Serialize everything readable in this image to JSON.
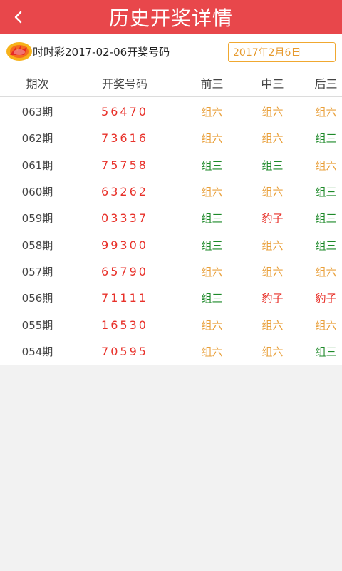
{
  "header": {
    "title": "历史开奖详情"
  },
  "info": {
    "label": "时时彩2017-02-06开奖号码",
    "date_value": "2017年2月6日"
  },
  "table": {
    "columns": [
      "期次",
      "开奖号码",
      "前三",
      "中三",
      "后三"
    ],
    "rows": [
      {
        "period": "063期",
        "number": "56470",
        "front": "组六",
        "middle": "组六",
        "back": "组六"
      },
      {
        "period": "062期",
        "number": "73616",
        "front": "组六",
        "middle": "组六",
        "back": "组三"
      },
      {
        "period": "061期",
        "number": "75758",
        "front": "组三",
        "middle": "组三",
        "back": "组六"
      },
      {
        "period": "060期",
        "number": "63262",
        "front": "组六",
        "middle": "组六",
        "back": "组三"
      },
      {
        "period": "059期",
        "number": "03337",
        "front": "组三",
        "middle": "豹子",
        "back": "组三"
      },
      {
        "period": "058期",
        "number": "99300",
        "front": "组三",
        "middle": "组六",
        "back": "组三"
      },
      {
        "period": "057期",
        "number": "65790",
        "front": "组六",
        "middle": "组六",
        "back": "组六"
      },
      {
        "period": "056期",
        "number": "71111",
        "front": "组三",
        "middle": "豹子",
        "back": "豹子"
      },
      {
        "period": "055期",
        "number": "16530",
        "front": "组六",
        "middle": "组六",
        "back": "组六"
      },
      {
        "period": "054期",
        "number": "70595",
        "front": "组六",
        "middle": "组六",
        "back": "组三"
      }
    ]
  },
  "colors": {
    "header_bg": "#e8474b",
    "group_six": "#e9a03b",
    "group_three": "#1e8a2a",
    "leopard": "#e8312a",
    "number": "#e8312a"
  }
}
